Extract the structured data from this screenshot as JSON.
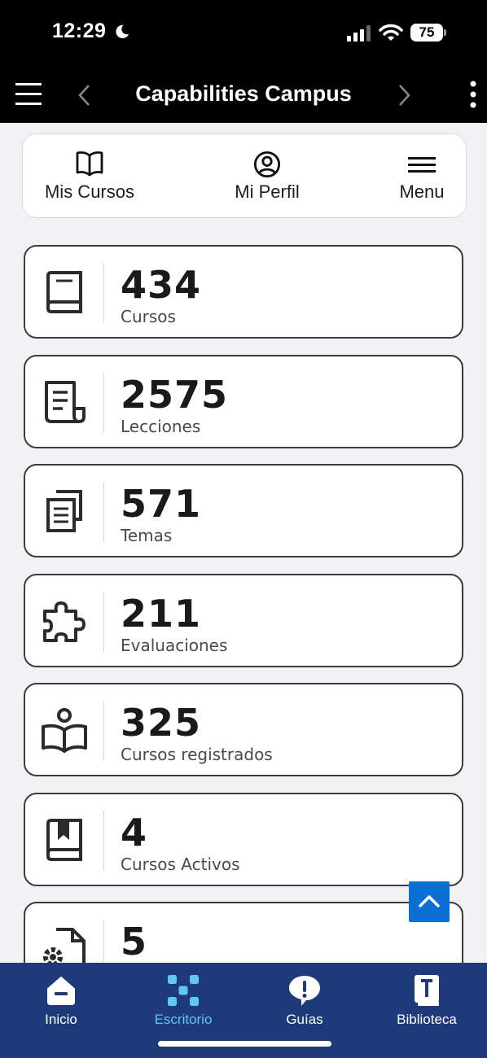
{
  "status_bar": {
    "time": "12:29",
    "battery": "75"
  },
  "header": {
    "title": "Capabilities Campus"
  },
  "top_nav": [
    {
      "label": "Mis Cursos",
      "icon": "open-book-icon"
    },
    {
      "label": "Mi Perfil",
      "icon": "user-circle-icon"
    },
    {
      "label": "Menu",
      "icon": "menu-icon"
    }
  ],
  "stats": [
    {
      "value": "434",
      "label": "Cursos",
      "icon": "book-icon"
    },
    {
      "value": "2575",
      "label": "Lecciones",
      "icon": "document-icon"
    },
    {
      "value": "571",
      "label": "Temas",
      "icon": "copy-documents-icon"
    },
    {
      "value": "211",
      "label": "Evaluaciones",
      "icon": "puzzle-icon"
    },
    {
      "value": "325",
      "label": "Cursos registrados",
      "icon": "reader-icon"
    },
    {
      "value": "4",
      "label": "Cursos Activos",
      "icon": "bookmark-book-icon"
    },
    {
      "value": "5",
      "label": "",
      "icon": "file-gear-icon"
    }
  ],
  "tabs": [
    {
      "label": "Inicio",
      "icon": "home-icon",
      "active": false
    },
    {
      "label": "Escritorio",
      "icon": "dashboard-icon",
      "active": true
    },
    {
      "label": "Guías",
      "icon": "exclamation-bubble-icon",
      "active": false
    },
    {
      "label": "Biblioteca",
      "icon": "library-book-icon",
      "active": false
    }
  ],
  "colors": {
    "tabbar": "#1e3a7b",
    "active_tab": "#5fc7f0",
    "scroll_button": "#0b6fd6"
  }
}
